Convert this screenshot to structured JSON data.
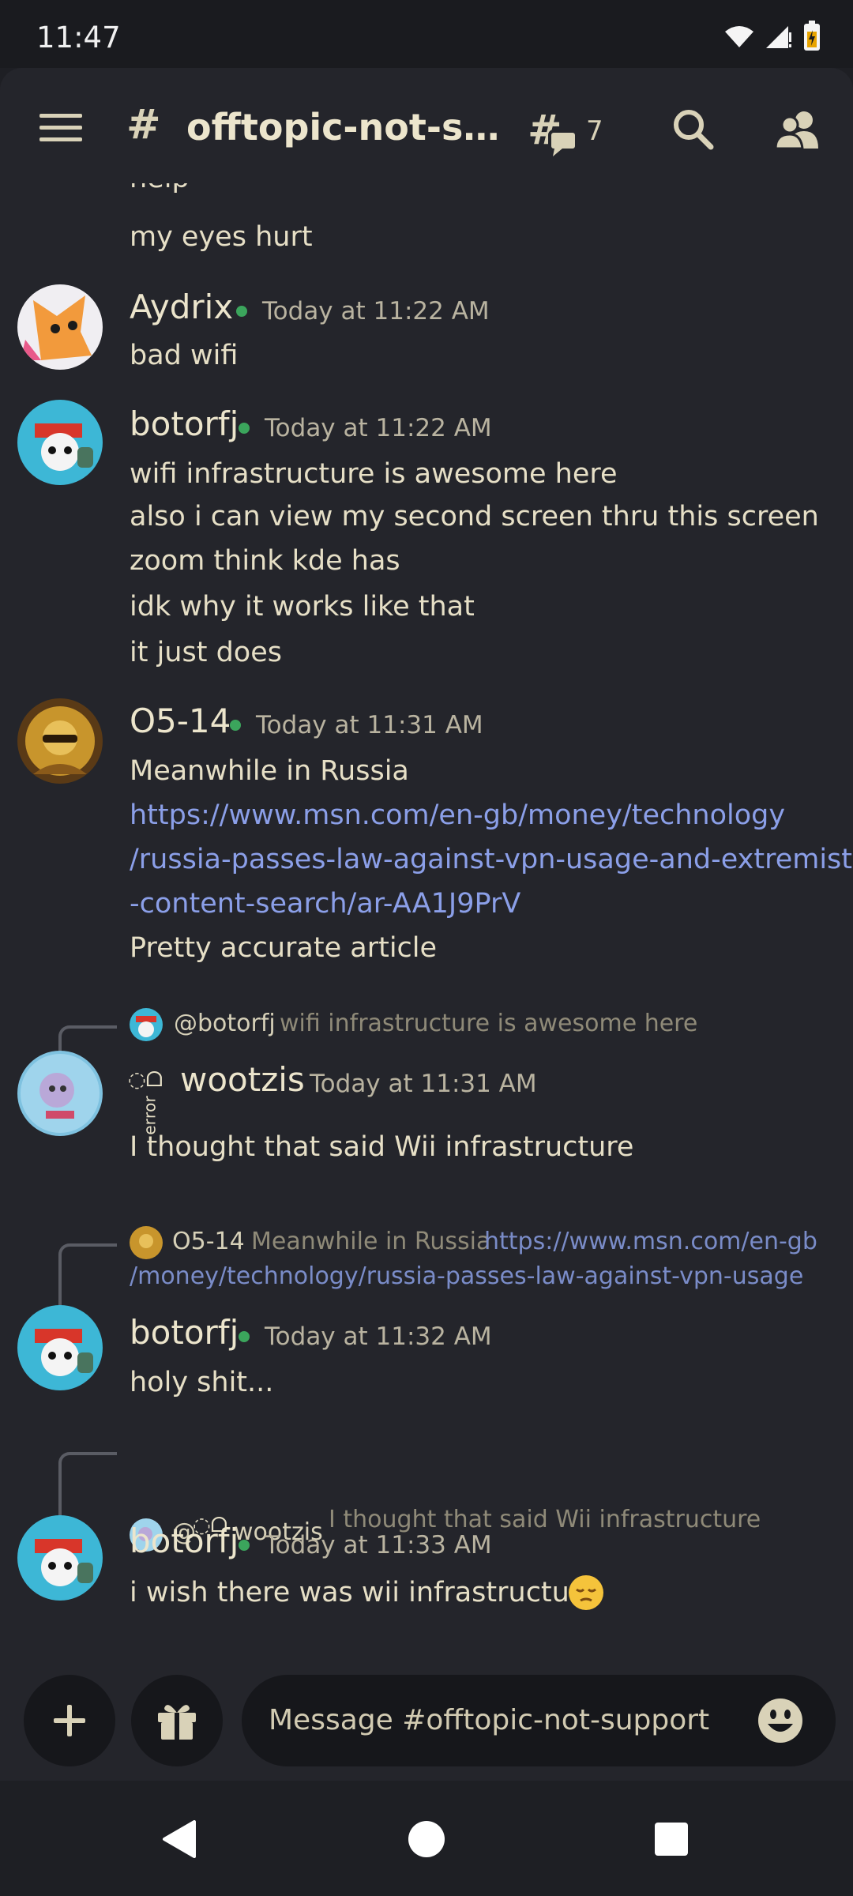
{
  "status": {
    "time": "11:47"
  },
  "header": {
    "title": "offtopic-not-support",
    "thread_count": "7"
  },
  "messages": {
    "cont": {
      "line0": "help",
      "line1": "my eyes hurt"
    },
    "m1": {
      "user": "Aydrix",
      "time": "Today at 11:22 AM",
      "lines": [
        "bad wifi"
      ]
    },
    "m2": {
      "user": "botorfj",
      "time": "Today at 11:22 AM",
      "lines": [
        "wifi infrastructure is awesome here",
        "also i can view my second screen thru this screen",
        "zoom think kde has",
        "idk why it works like that",
        "it just does"
      ]
    },
    "m3": {
      "user": "O5-14",
      "time": "Today at 11:31 AM",
      "lines": [
        "Meanwhile in Russia",
        "https://www.msn.com/en-gb/money/technology",
        "/russia-passes-law-against-vpn-usage-and-extremist",
        "-content-search/ar-AA1J9PrV",
        "Pretty accurate article"
      ]
    },
    "m4": {
      "reply_user": "@botorfj",
      "reply_text": "wifi infrastructure is awesome here",
      "user": "wootzis",
      "time": "Today at 11:31 AM",
      "lines": [
        "I thought that said Wii infrastructure"
      ]
    },
    "m5": {
      "reply_user": "O5-14",
      "reply_text": "Meanwhile in Russia",
      "reply_link1": "https://www.msn.com/en-gb",
      "reply_link2": "/money/technology/russia-passes-law-against-vpn-usage",
      "user": "botorfj",
      "time": "Today at 11:32 AM",
      "lines": [
        "holy shit..."
      ]
    },
    "m6": {
      "reply_user": "@",
      "reply_user2": "wootzis",
      "reply_text": "I thought that said Wii infrastructure",
      "user": "botorfj",
      "time": "Today at 11:33 AM",
      "lines": [
        "i wish there was wii infrastructure"
      ]
    }
  },
  "composer": {
    "placeholder": "Message #offtopic-not-support"
  },
  "icons": {
    "menu": "hamburger-icon",
    "threads": "threads-icon",
    "search": "search-icon",
    "members": "members-icon",
    "add": "plus-icon",
    "gift": "gift-icon",
    "emoji": "emoji-icon",
    "back": "back-triangle-icon",
    "home": "home-circle-icon",
    "recents": "recents-square-icon"
  },
  "colors": {
    "online": "#3ba55c",
    "link": "#8b9fe8",
    "background": "#24252b"
  }
}
